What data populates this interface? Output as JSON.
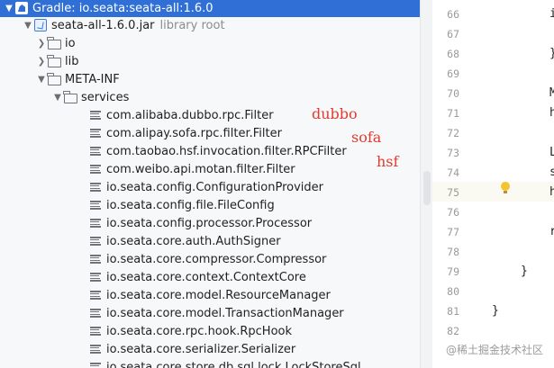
{
  "tree": {
    "root": {
      "label": "Gradle: io.seata:seata-all:1.6.0"
    },
    "jar": {
      "label": "seata-all-1.6.0.jar",
      "hint": "library root"
    },
    "folders": {
      "io": "io",
      "lib": "lib",
      "meta_inf": "META-INF",
      "services": "services"
    },
    "files": [
      "com.alibaba.dubbo.rpc.Filter",
      "com.alipay.sofa.rpc.filter.Filter",
      "com.taobao.hsf.invocation.filter.RPCFilter",
      "com.weibo.api.motan.filter.Filter",
      "io.seata.config.ConfigurationProvider",
      "io.seata.config.file.FileConfig",
      "io.seata.config.processor.Processor",
      "io.seata.core.auth.AuthSigner",
      "io.seata.core.compressor.Compressor",
      "io.seata.core.context.ContextCore",
      "io.seata.core.model.ResourceManager",
      "io.seata.core.model.TransactionManager",
      "io.seata.core.rpc.hook.RpcHook",
      "io.seata.core.serializer.Serializer",
      "io.seata.core.store.db.sql.lock.LockStoreSql"
    ]
  },
  "annotations": {
    "dubbo": "dubbo",
    "sofa": "sofa",
    "hsf": "hsf"
  },
  "editor": {
    "line_numbers": [
      "66",
      "67",
      "68",
      "69",
      "70",
      "71",
      "72",
      "73",
      "74",
      "75",
      "76",
      "77",
      "78",
      "79",
      "80",
      "81",
      "82"
    ],
    "fragments": {
      "l66": "i",
      "l68": "}",
      "l70": "M",
      "l71": "h",
      "l73": "L",
      "l74": "s",
      "l75": "h",
      "l77": "r",
      "l79": "}",
      "l81": "}"
    }
  },
  "watermark": "@稀土掘金技术社区",
  "colors": {
    "selection": "#2f6fd6",
    "annotation": "#e23a2e",
    "tree_bg": "#f7f8fa"
  }
}
